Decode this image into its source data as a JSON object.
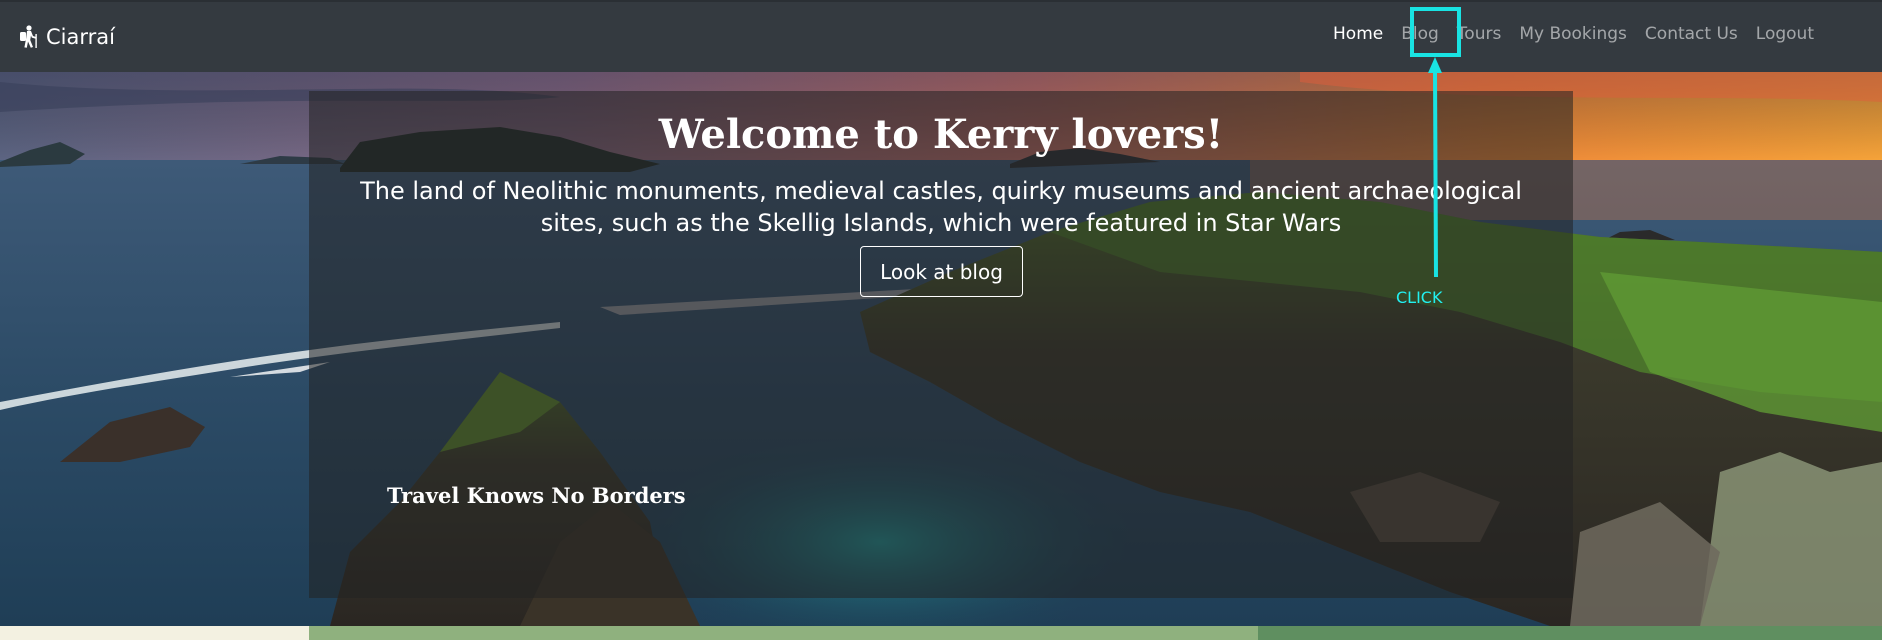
{
  "navbar": {
    "brand": "Ciarraí",
    "brand_icon": "hiker-icon",
    "links": [
      {
        "label": "Home",
        "active": true
      },
      {
        "label": "Blog",
        "active": false
      },
      {
        "label": "Tours",
        "active": false
      },
      {
        "label": "My Bookings",
        "active": false
      },
      {
        "label": "Contact Us",
        "active": false
      },
      {
        "label": "Logout",
        "active": false
      }
    ],
    "background": "#343a40"
  },
  "annotation": {
    "label": "CLICK",
    "target": "Blog",
    "color": "#19e3e3"
  },
  "hero": {
    "title": "Welcome to Kerry lovers!",
    "subtitle": "The land of Neolithic monuments, medieval castles, quirky museums and ancient archaeological sites, such as the Skellig Islands, which were featured in Star Wars",
    "button_label": "Look at blog",
    "tagline": "Travel Knows No Borders"
  },
  "colors": {
    "accent_highlight": "#19e3e3",
    "overlay": "rgba(35,35,35,0.55)",
    "strip_left": "#f3f1e1",
    "strip_middle": "#8fb17e",
    "strip_right": "#5f8f60"
  }
}
